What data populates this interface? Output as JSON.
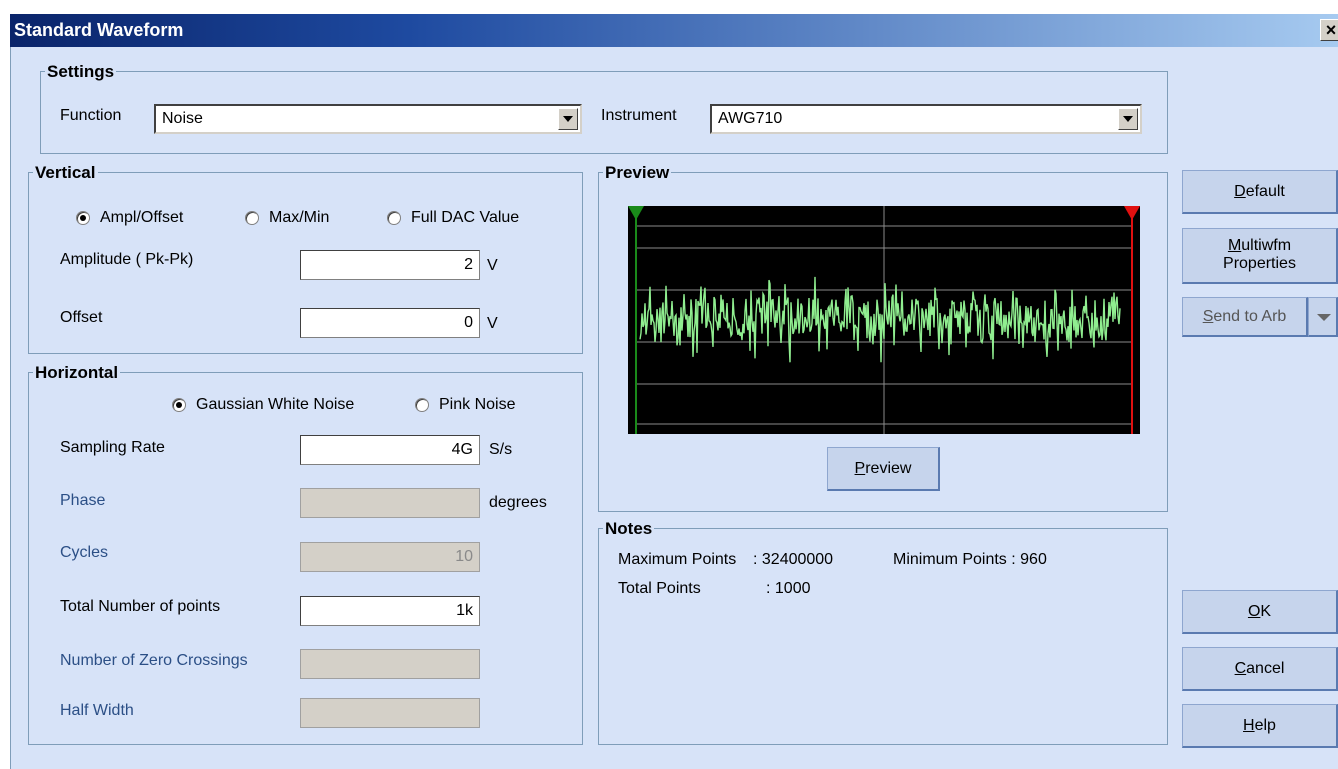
{
  "window": {
    "title": "Standard Waveform",
    "close_label": "×"
  },
  "settings": {
    "legend": "Settings",
    "function_label": "Function",
    "function_value": "Noise",
    "instrument_label": "Instrument",
    "instrument_value": "AWG710"
  },
  "vertical": {
    "legend": "Vertical",
    "radios": [
      {
        "label": "Ampl/Offset",
        "selected": true
      },
      {
        "label": "Max/Min",
        "selected": false
      },
      {
        "label": "Full DAC Value",
        "selected": false
      }
    ],
    "amplitude_label": "Amplitude ( Pk-Pk)",
    "amplitude_value": "2",
    "amplitude_unit": "V",
    "offset_label": "Offset",
    "offset_value": "0",
    "offset_unit": "V"
  },
  "horizontal": {
    "legend": "Horizontal",
    "radios": [
      {
        "label": "Gaussian White Noise",
        "selected": true
      },
      {
        "label": "Pink Noise",
        "selected": false
      }
    ],
    "sampling_rate_label": "Sampling Rate",
    "sampling_rate_value": "4G",
    "sampling_rate_unit": "S/s",
    "phase_label": "Phase",
    "phase_value": "",
    "phase_unit": "degrees",
    "cycles_label": "Cycles",
    "cycles_value": "10",
    "total_points_label": "Total Number of points",
    "total_points_value": "1k",
    "zero_crossings_label": "Number of Zero Crossings",
    "zero_crossings_value": "",
    "half_width_label": "Half Width",
    "half_width_value": ""
  },
  "preview": {
    "legend": "Preview",
    "button_label": "Preview",
    "button_mnemonic": "P",
    "button_rest": "review",
    "trace_color": "#90ee90",
    "start_marker_color": "#1a8a1a",
    "end_marker_color": "#e01010"
  },
  "notes": {
    "legend": "Notes",
    "max_points_label": "Maximum Points",
    "max_points_value": ": 32400000",
    "min_points_label": "Minimum Points : 960",
    "total_points_label": "Total Points",
    "total_points_value": ": 1000"
  },
  "buttons": {
    "default_mnemonic": "D",
    "default_rest": "efault",
    "multiwfm_line1_mnemonic": "M",
    "multiwfm_line1_rest": "ultiwfm",
    "multiwfm_line2": "Properties",
    "send_mnemonic": "S",
    "send_rest": "end to Arb",
    "ok_mnemonic": "O",
    "ok_rest": "K",
    "cancel_mnemonic": "C",
    "cancel_rest": "ancel",
    "help_mnemonic": "H",
    "help_rest": "elp"
  }
}
